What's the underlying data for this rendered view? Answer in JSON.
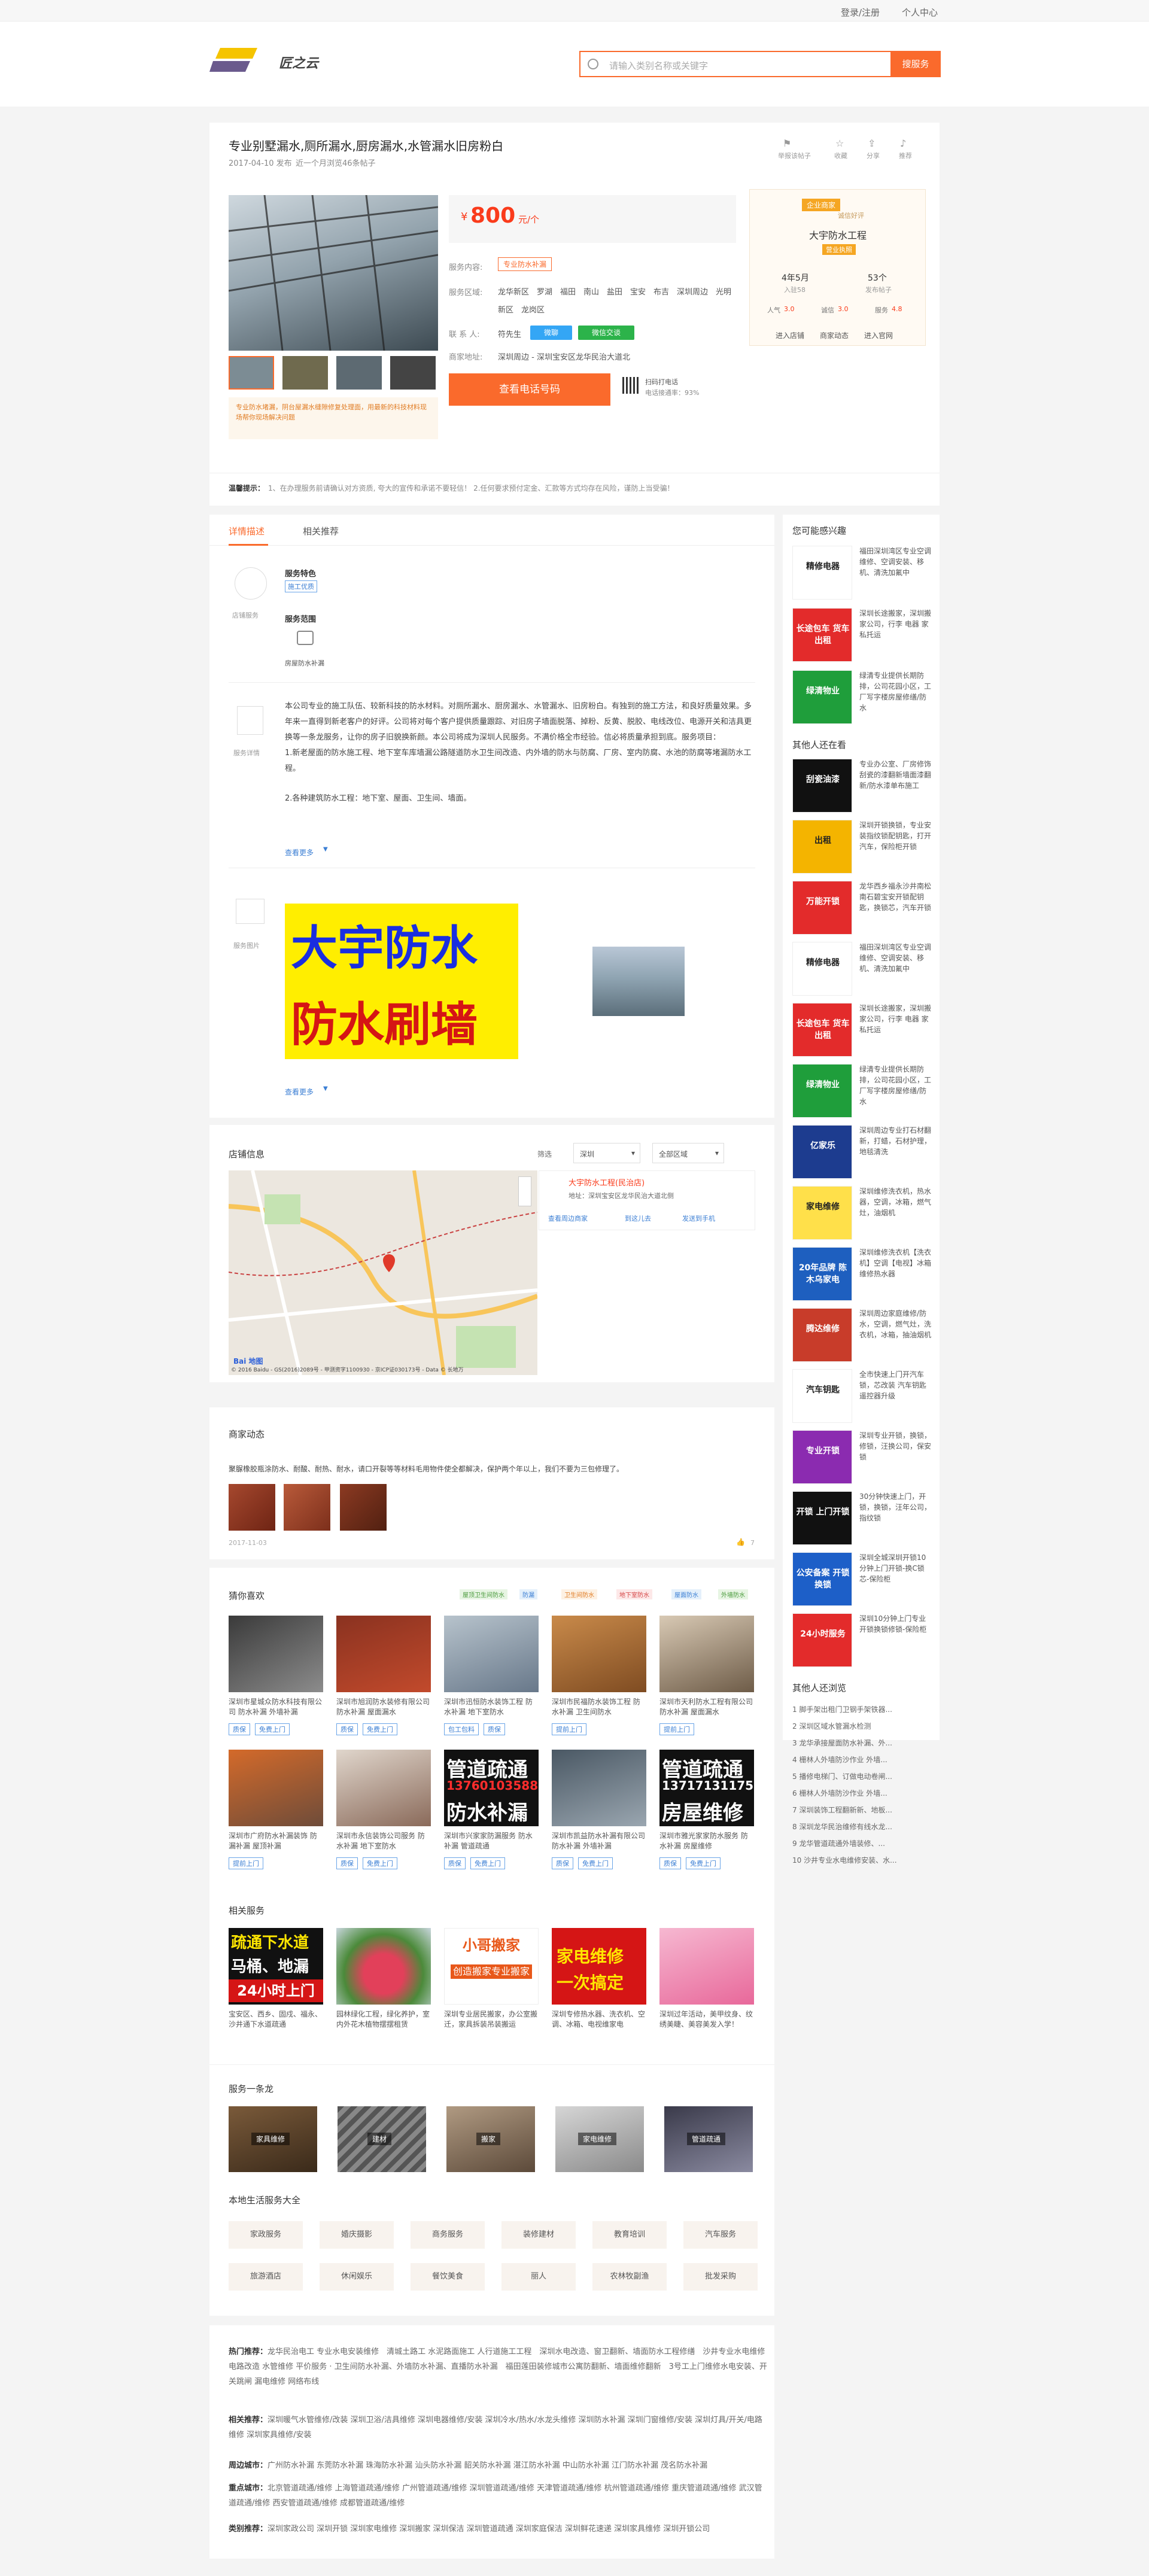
{
  "topbar": {
    "login": "登录/注册",
    "center": "个人中心"
  },
  "header": {
    "logo_text": "匠之云",
    "search_placeholder": "请输入类别名称或关键字",
    "search_btn": "搜服务"
  },
  "service": {
    "title": "专业别墅漏水,厕所漏水,厨房漏水,水管漏水旧房粉白",
    "date": "2017-04-10 发布",
    "visits": "近一个月浏览46条帖子",
    "actions": [
      "举报该帖子",
      "收藏",
      "分享",
      "推荐"
    ],
    "img_caption": "专业防水堵漏，阴台屋漏水缝隙修复处理面，用最新的科技材料现场帮你现场解决问题",
    "price": "800",
    "price_currency": "¥",
    "price_unit": "元/个",
    "content_label": "服务内容:",
    "content_tag": "专业防水补漏",
    "area_label": "服务区域:",
    "areas": "龙华新区　罗湖　福田　南山　盐田　宝安　布吉　深圳周边　光明新区　龙岗区",
    "contact_label": "联 系 人:",
    "contact": "符先生",
    "chat1": "微聊",
    "chat2": "微信交谈",
    "addr_label": "商家地址:",
    "addr": "深圳周边 - 深圳宝安区龙华民治大道北",
    "call_btn": "查看电话号码",
    "qr_text1": "扫码打电话",
    "qr_text2": "电话接通率：93%"
  },
  "shop": {
    "badge": "企业商家",
    "subbadge": "诚信好评",
    "name": "大宇防水工程",
    "verified": "营业执照",
    "stats": [
      {
        "value": "4年5月",
        "label": "入驻58"
      },
      {
        "value": "53个",
        "label": "发布帖子"
      }
    ],
    "ratings": [
      {
        "label": "人气",
        "value": "3.0"
      },
      {
        "label": "诚信",
        "value": "3.0"
      },
      {
        "label": "服务",
        "value": "4.8"
      }
    ],
    "links": [
      "进入店铺",
      "商家动态",
      "进入官网"
    ]
  },
  "notice": {
    "label": "温馨提示：",
    "text": "1、在办理服务前请确认对方资质, 夸大的宣传和承诺不要轻信！ 2.任何要求预付定金、汇款等方式均存在风险，谨防上当受骗！"
  },
  "tabs": [
    "详情描述",
    "相关推荐"
  ],
  "detail": {
    "feature_label": "服务特色",
    "feature_tag": "施工优质",
    "scope_label": "服务范围",
    "scope_item": "房屋防水补漏",
    "icon1": "店铺服务",
    "icon2": "服务详情",
    "icon3": "服务图片",
    "desc": [
      "本公司专业的施工队伍、较新科技的防水材料。对厕所漏水、厨房漏水、水管漏水、旧房粉白。有独到的施工方法，和良好质量效果。多年来一直得到新老客户的好评。公司将对每个客户提供质量跟踪、对旧房子墙面脱落、掉粉、反黄、脱胶、电线改位、电源开关和洁具更换等一条龙服务，让你的房子旧貌换新颜。本公司将成为深圳人民服务。不满价格全市经验。信必将质量承担到底。服务项目：",
      "1.新老屋面的防水施工程、地下室车库墙漏公路隧道防水卫生间改造、内外墙的防水与防腐、厂房、室内防腐、水池的防腐等堵漏防水工程。",
      "2.各种建筑防水工程：地下室、屋面、卫生间、墙面。"
    ],
    "more": "查看更多",
    "poster_top": "大宇防水",
    "poster_bot": "防水刷墙",
    "more2": "查看更多"
  },
  "map": {
    "title": "店铺信息",
    "filter": "筛选",
    "sel1": "深圳",
    "sel2": "全部区域",
    "shop": "大宇防水工程(民治店)",
    "addr": "地址：深圳宝安区龙华民治大道北侧",
    "a1": "查看周边商家",
    "a2": "到这儿去",
    "a3": "发送到手机",
    "attr": "© 2016 Baidu - GS(2016)2089号 - 甲测资字1100930 - 京ICP证030173号 - Data © 长地万"
  },
  "dynamics": {
    "title": "商家动态",
    "text": "聚脲橡胶瓶涂防水、耐酸、耐热、耐水，请口开裂等等材料毛用物件使全都解决，保护两个年以上，我们不要为三包修理了。",
    "date": "2017-11-03",
    "likes": "7"
  },
  "guess": {
    "title": "猜你喜欢",
    "tags": [
      "屋顶卫生间防水",
      "防漏",
      "卫生间防水",
      "地下室防水",
      "屋面防水",
      "外墙防水"
    ],
    "items": [
      {
        "cap": "深圳市星城众防水科技有限公司 防水补漏 外墙补漏",
        "t1": "质保",
        "t2": "免费上门"
      },
      {
        "cap": "深圳市旭润防水装修有限公司 防水补漏 屋面漏水",
        "t1": "质保",
        "t2": "免费上门"
      },
      {
        "cap": "深圳市迅恒防水装饰工程 防水补漏 地下室防水",
        "t1": "包工包料",
        "t2": "质保"
      },
      {
        "cap": "深圳市民福防水装饰工程 防水补漏 卫生间防水",
        "t1": "提前上门",
        "t2": ""
      },
      {
        "cap": "深圳市天利防水工程有限公司 防水补漏 屋面漏水",
        "t1": "提前上门",
        "t2": ""
      },
      {
        "cap": "深圳市广府防水补漏装饰 防漏补漏 屋顶补漏",
        "t1": "提前上门",
        "t2": ""
      },
      {
        "cap": "深圳市永信装饰公司服务 防水补漏 地下室防水",
        "t1": "质保",
        "t2": "免费上门"
      },
      {
        "cap": "深圳市兴家家防漏服务 防水补漏 管道疏通",
        "t1": "质保",
        "t2": "免费上门"
      },
      {
        "cap": "深圳市凯益防水补漏有限公司 防水补漏 外墙补漏",
        "t1": "质保",
        "t2": "免费上门"
      },
      {
        "cap": "深圳市雅光家家防水服务 防水补漏 房屋维修",
        "t1": "质保",
        "t2": "免费上门"
      }
    ],
    "banner1": "管道疏通",
    "banner1b": "13760103588",
    "banner1c": "防水补漏",
    "banner2": "管道疏通",
    "banner2b": "13717131175",
    "banner2c": "房屋维修"
  },
  "related": {
    "title": "相关服务",
    "items": [
      {
        "cap": "宝安区、西乡、固戍、福永、沙井通下水道疏通",
        "big1": "疏通下水道",
        "big2": "马桶、地漏",
        "big3": "24小时上门"
      },
      {
        "cap": "园林绿化工程，绿化养护，室内外花木植物摆摆租赁"
      },
      {
        "cap": "深圳专业居民搬家，办公室搬迁，家具拆装吊装搬运",
        "big1": "小哥搬家",
        "big2": "创造搬家专业搬家"
      },
      {
        "cap": "深圳专修热水器、洗衣机、空调、冰箱、电视维家电",
        "big1": "家电维修",
        "big2": "一次搞定"
      },
      {
        "cap": "深圳过年活动，美甲纹身、纹绣美睫、美容美发入学！"
      }
    ]
  },
  "oneline": {
    "title": "服务一条龙",
    "items": [
      "家具维修",
      "建材",
      "搬家",
      "家电维修",
      "管道疏通"
    ]
  },
  "local": {
    "title": "本地生活服务大全",
    "cats": [
      "家政服务",
      "婚庆摄影",
      "商务服务",
      "装修建材",
      "教育培训",
      "汽车服务",
      "旅游酒店",
      "休闲娱乐",
      "餐饮美食",
      "丽人",
      "农林牧副渔",
      "批发采购"
    ]
  },
  "footer": {
    "rows": [
      {
        "label": "热门推荐：",
        "text": "龙华民治电工 专业水电安装维修　清城土路工 水泥路面施工 人行道施工工程　深圳水电改造、窗卫翻新、墙面防水工程修缮　沙井专业水电维修 电路改造 水管维修 平价服务 · 卫生间防水补漏、外墙防水补漏、直播防水补漏　福田莲田装修城市公寓防翻新、墙面维修翻新　3号工上门维修水电安装、开关跳闸 漏电维修 网络布线"
      },
      {
        "label": "相关推荐：",
        "text": "深圳暖气水管维修/改装 深圳卫浴/洁具维修 深圳电器维修/安装 深圳冷水/热水/水龙头维修 深圳防水补漏 深圳门窗维修/安装 深圳灯具/开关/电路维修 深圳家具维修/安装"
      },
      {
        "label": "周边城市：",
        "text": "广州防水补漏 东莞防水补漏 珠海防水补漏 汕头防水补漏 韶关防水补漏 湛江防水补漏 中山防水补漏 江门防水补漏 茂名防水补漏"
      },
      {
        "label": "重点城市：",
        "text": "北京管道疏通/维修 上海管道疏通/维修 广州管道疏通/维修 深圳管道疏通/维修 天津管道疏通/维修 杭州管道疏通/维修 重庆管道疏通/维修 武汉管道疏通/维修 西安管道疏通/维修 成都管道疏通/维修"
      },
      {
        "label": "类别推荐：",
        "text": "深圳家政公司 深圳开锁 深圳家电维修 深圳搬家 深圳保洁 深圳管道疏通 深圳家庭保洁 深圳鲜花速递 深圳家具维修 深圳开锁公司"
      }
    ]
  },
  "sidebar": {
    "maybe_title": "您可能感兴趣",
    "others_title": "其他人还在看",
    "browse_title": "其他人还浏览",
    "maybe": [
      {
        "cap": "福田深圳湾区专业空调维修、空调安装、移机、清洗加氟中",
        "img": "精修电器",
        "bg": "#fff"
      },
      {
        "cap": "深圳长途搬家，深圳搬家公司，行李 电器 家私托运",
        "img": "长途包车 货车出租",
        "bg": "#e32b2b"
      },
      {
        "cap": "绿清专业提供长期防排，公司花园小区，工厂写字楼房屋修缮/防水",
        "img": "绿清物业",
        "bg": "#1f9e3b"
      }
    ],
    "others": [
      {
        "cap": "专业办公室、厂房修饰刮瓷的漆翻新墙面漆翻新/防水漆单布施工",
        "img": "刮瓷油漆",
        "bg": "#111"
      },
      {
        "cap": "深圳开锁换锁，专业安装指纹锁配钥匙，打开汽车，保险柜开锁",
        "img": "出租",
        "bg": "#f4b400"
      },
      {
        "cap": "龙华西乡福永沙井南松南石碧宝安开锁配钥匙，换锁芯，汽车开锁",
        "img": "万能开锁",
        "bg": "#e32b2b"
      },
      {
        "cap": "福田深圳湾区专业空调维修、空调安装、移机、清洗加氟中",
        "img": "精修电器",
        "bg": "#fff"
      },
      {
        "cap": "深圳长途搬家，深圳搬家公司，行李 电器 家私托运",
        "img": "长途包车 货车出租",
        "bg": "#e32b2b"
      },
      {
        "cap": "绿清专业提供长期防排，公司花园小区，工厂写字楼房屋修缮/防水",
        "img": "绿清物业",
        "bg": "#1f9e3b"
      },
      {
        "cap": "深圳周边专业打石材翻新，打蜡，石材护理，地毯清洗",
        "img": "亿家乐",
        "bg": "#1d3c8f"
      },
      {
        "cap": "深圳维修洗衣机，热水器，空调，冰箱，燃气灶，油烟机",
        "img": "家电维修",
        "bg": "#ffe04a"
      },
      {
        "cap": "深圳维修洗衣机【洗衣机】空调【电视】冰箱维修热水器",
        "img": "20年品牌 陈木乌家电",
        "bg": "#1e5fbf"
      },
      {
        "cap": "深圳周边家庭维修/防水，空调，燃气灶，洗衣机，冰箱，抽油烟机",
        "img": "腾达维修",
        "bg": "#c83c2a"
      },
      {
        "cap": "全市快速上门开汽车锁，芯改装 汽车钥匙遥控器升级",
        "img": "汽车钥匙",
        "bg": "#fff"
      },
      {
        "cap": "深圳专业开锁，换锁，修锁，汪换公司，保安锁",
        "img": "专业开锁",
        "bg": "#8b2bb0"
      },
      {
        "cap": "30分钟快速上门，开锁，换锁，汪年公司，指纹锁",
        "img": "开锁 上门开锁",
        "bg": "#111"
      },
      {
        "cap": "深圳全城深圳开锁10分钟上门开锁-换C锁芯-保险柜",
        "img": "公安备案 开锁 换锁",
        "bg": "#1d5fc8"
      },
      {
        "cap": "深圳10分钟上门专业开锁换锁修锁-保险柜",
        "img": "24小时服务",
        "bg": "#e32b2b"
      }
    ],
    "browse": [
      "1 脚手架出租门卫钢手架铁器...",
      "2 深圳区域水管漏水检测",
      "3 龙华承接屋面防水补漏、外...",
      "4 栅林人外墙防沙作业 外墙...",
      "5 播修电梯门、订做电动卷闸...",
      "6 栅林人外墙防沙作业 外墙...",
      "7 深圳装饰工程翻新新、地板...",
      "8 深圳龙华民治维修有线水龙...",
      "9 龙华管道疏通外墙装修、...",
      "10 沙井专业水电维修安装、水..."
    ]
  }
}
